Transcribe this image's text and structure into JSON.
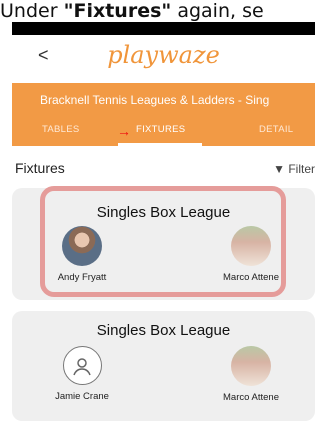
{
  "caption": {
    "prefix": "Under ",
    "bold": "\"Fixtures\"",
    "suffix": " again, se"
  },
  "header": {
    "back_label": "<",
    "logo": "playwaze"
  },
  "league": {
    "title": "Bracknell Tennis Leagues & Ladders - Sing"
  },
  "tabs": [
    {
      "label": "TABLES"
    },
    {
      "label": "FIXTURES"
    },
    {
      "label": "DETAIL"
    }
  ],
  "section": {
    "title": "Fixtures",
    "filter_label": "Filter"
  },
  "fixtures": [
    {
      "title": "Singles Box League",
      "player_left": "Andy Fryatt",
      "player_right": "Marco Attene"
    },
    {
      "title": "Singles Box League",
      "player_left": "Jamie Crane",
      "player_right": "Marco Attene"
    }
  ],
  "colors": {
    "brand_orange": "#f29a45",
    "highlight_pink": "#e59c9a",
    "annotation_arrow": "#e11111"
  }
}
